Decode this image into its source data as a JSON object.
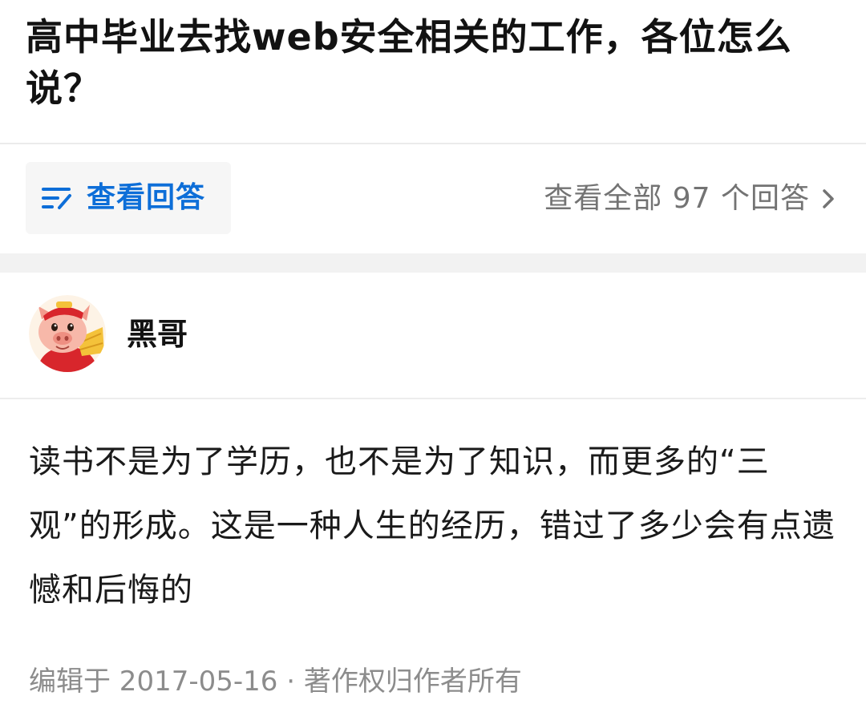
{
  "question": {
    "title": "高中毕业去找web安全相关的工作，各位怎么说？"
  },
  "actions": {
    "view_answer_label": "查看回答",
    "view_all_label": "查看全部 97 个回答",
    "answer_count": 97
  },
  "answer": {
    "author": {
      "name": "黑哥",
      "avatar_icon": "pig-cartoon-avatar"
    },
    "content": "读书不是为了学历，也不是为了知识，而更多的“三观”的形成。这是一种人生的经历，错过了多少会有点遗憾和后悔的",
    "meta": "编辑于 2017-05-16 · 著作权归作者所有"
  },
  "colors": {
    "accent": "#0d6ed8",
    "secondary_text": "#737373",
    "meta_text": "#8c8c8c",
    "section_gap": "#f2f2f2",
    "button_bg": "#f6f6f6"
  }
}
